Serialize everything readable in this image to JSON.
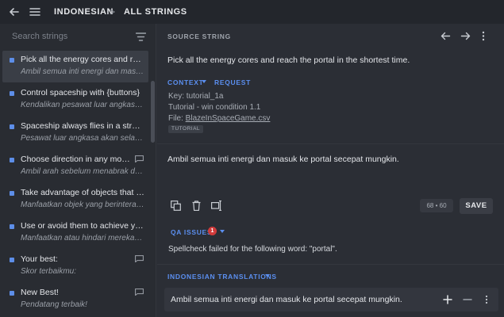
{
  "topbar": {
    "back_icon": "arrow-left-icon",
    "menu_icon": "hamburger-icon",
    "breadcrumb_language": "INDONESIAN",
    "breadcrumb_separator": ">",
    "breadcrumb_page": "ALL STRINGS"
  },
  "sidebar": {
    "search_placeholder": "Search strings",
    "filter_icon": "filter-icon",
    "items": [
      {
        "source": "Pick all the energy cores and reach t...",
        "translation": "Ambil semua inti energi dan masuk k...",
        "selected": true,
        "comment": false
      },
      {
        "source": "Control spaceship with {buttons}",
        "translation": "Kendalikan pesawat luar angkasa de...",
        "selected": false,
        "comment": false
      },
      {
        "source": "Spaceship always flies in a straight l...",
        "translation": "Pesawat luar angkasa akan selalu te...",
        "selected": false,
        "comment": false
      },
      {
        "source": "Choose direction in any moment...",
        "translation": "Ambil arah sebelum menabrak dindi...",
        "selected": false,
        "comment": true
      },
      {
        "source": "Take advantage of objects that inter...",
        "translation": "Manfaatkan objek yang berinteraksi ...",
        "selected": false,
        "comment": false
      },
      {
        "source": "Use or avoid them to achieve your g...",
        "translation": "Manfaatkan atau hindari mereka unt...",
        "selected": false,
        "comment": false
      },
      {
        "source": "Your best:",
        "translation": "Skor terbaikmu:",
        "selected": false,
        "comment": true
      },
      {
        "source": "New Best!",
        "translation": "Pendatang terbaik!",
        "selected": false,
        "comment": true
      }
    ]
  },
  "source": {
    "label": "SOURCE STRING",
    "text": "Pick all the energy cores and reach the portal in the shortest time.",
    "context_tab": "CONTEXT",
    "request_tab": "REQUEST",
    "key": "Key: tutorial_1a",
    "description": "Tutorial - win condition 1.1",
    "file_prefix": "File: ",
    "file_name": "BlazeInSpaceGame.csv",
    "tag": "TUTORIAL"
  },
  "editor": {
    "translation": "Ambil semua inti energi dan masuk ke portal secepat mungkin.",
    "counter": "68 • 60",
    "save_label": "SAVE"
  },
  "qa": {
    "label": "QA ISSUES",
    "count": "1",
    "message": "Spellcheck failed for the following word: \"portal\"."
  },
  "translations": {
    "label": "INDONESIAN TRANSLATIONS",
    "text": "Ambil semua inti energi dan masuk ke portal secepat mungkin."
  },
  "colors": {
    "accent": "#5b8ff0",
    "badge": "#d13b3b"
  }
}
